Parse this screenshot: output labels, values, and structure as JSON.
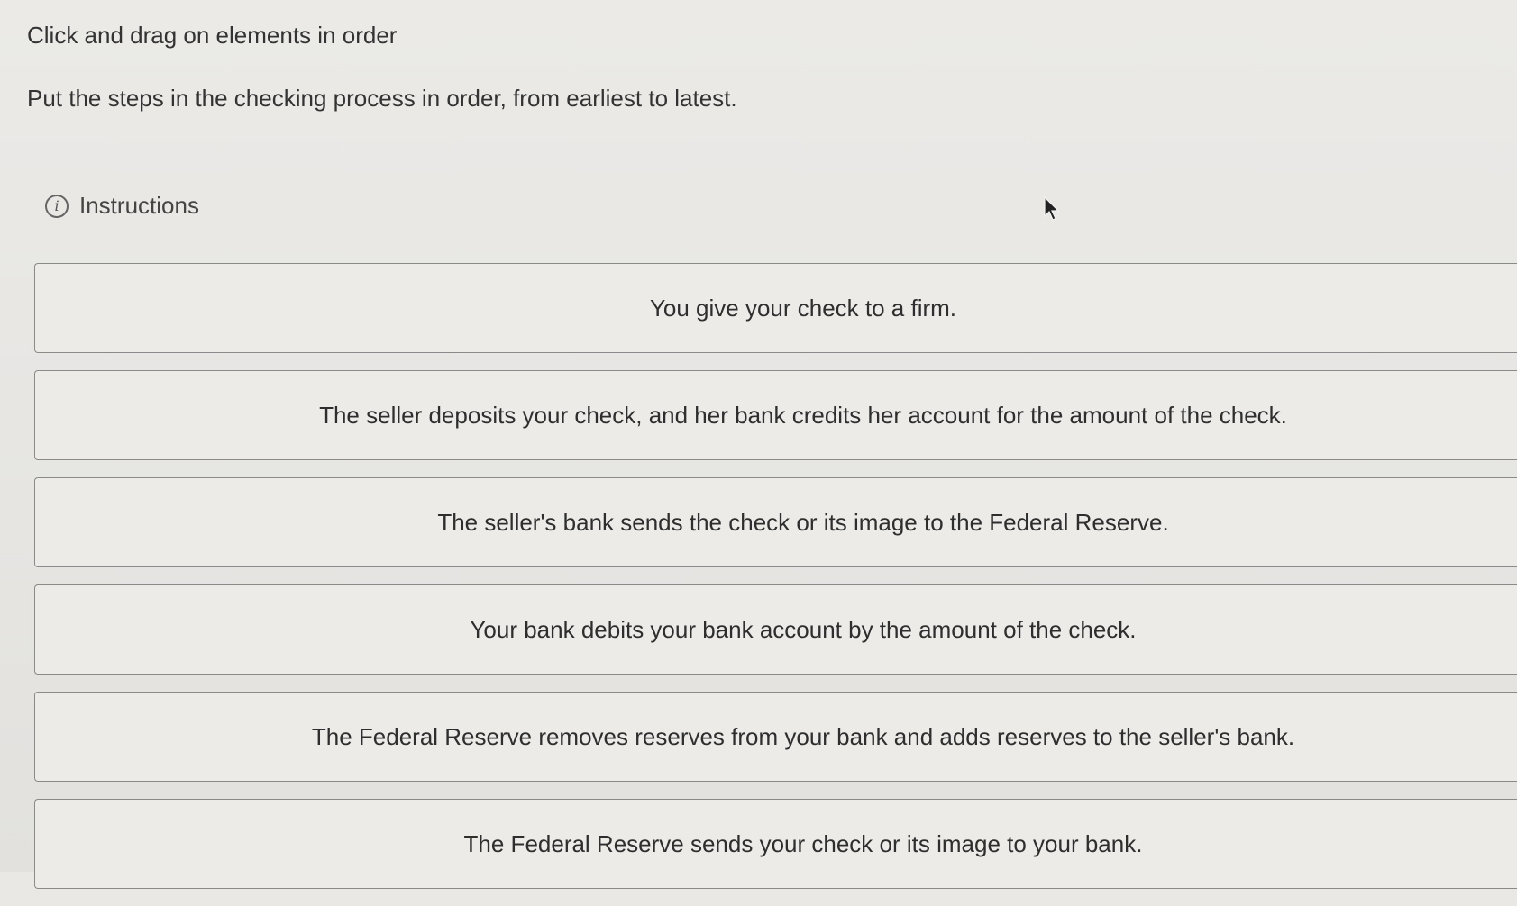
{
  "prompt": {
    "title": "Click and drag on elements in order",
    "body": "Put the steps in the checking process in order, from earliest to latest."
  },
  "instructions": {
    "icon": "info-icon",
    "label": "Instructions"
  },
  "steps": [
    {
      "label": "You give your check to a firm."
    },
    {
      "label": "The seller deposits your check, and her bank credits her account for the amount of the check."
    },
    {
      "label": "The seller's bank sends the check or its image to the Federal Reserve."
    },
    {
      "label": "Your bank debits your bank account by the amount of the check."
    },
    {
      "label": "The Federal Reserve removes reserves from your bank and adds reserves to the seller's bank."
    },
    {
      "label": "The Federal Reserve sends your check or its image to your bank."
    }
  ]
}
